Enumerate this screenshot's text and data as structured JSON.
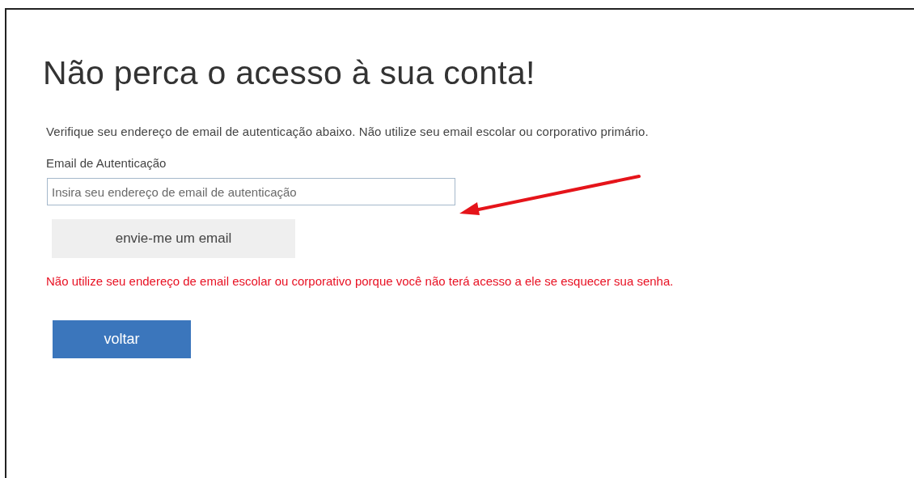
{
  "title": "Não perca o acesso à sua conta!",
  "instruction": "Verifique seu endereço de email de autenticação abaixo. Não utilize seu email escolar ou corporativo primário.",
  "email_field": {
    "label": "Email de Autenticação",
    "placeholder": "Insira seu endereço de email de autenticação"
  },
  "send_button": "envie-me um email",
  "warning": "Não utilize seu endereço de email escolar ou corporativo porque você não terá acesso a ele se esquecer sua senha.",
  "back_button": "voltar"
}
